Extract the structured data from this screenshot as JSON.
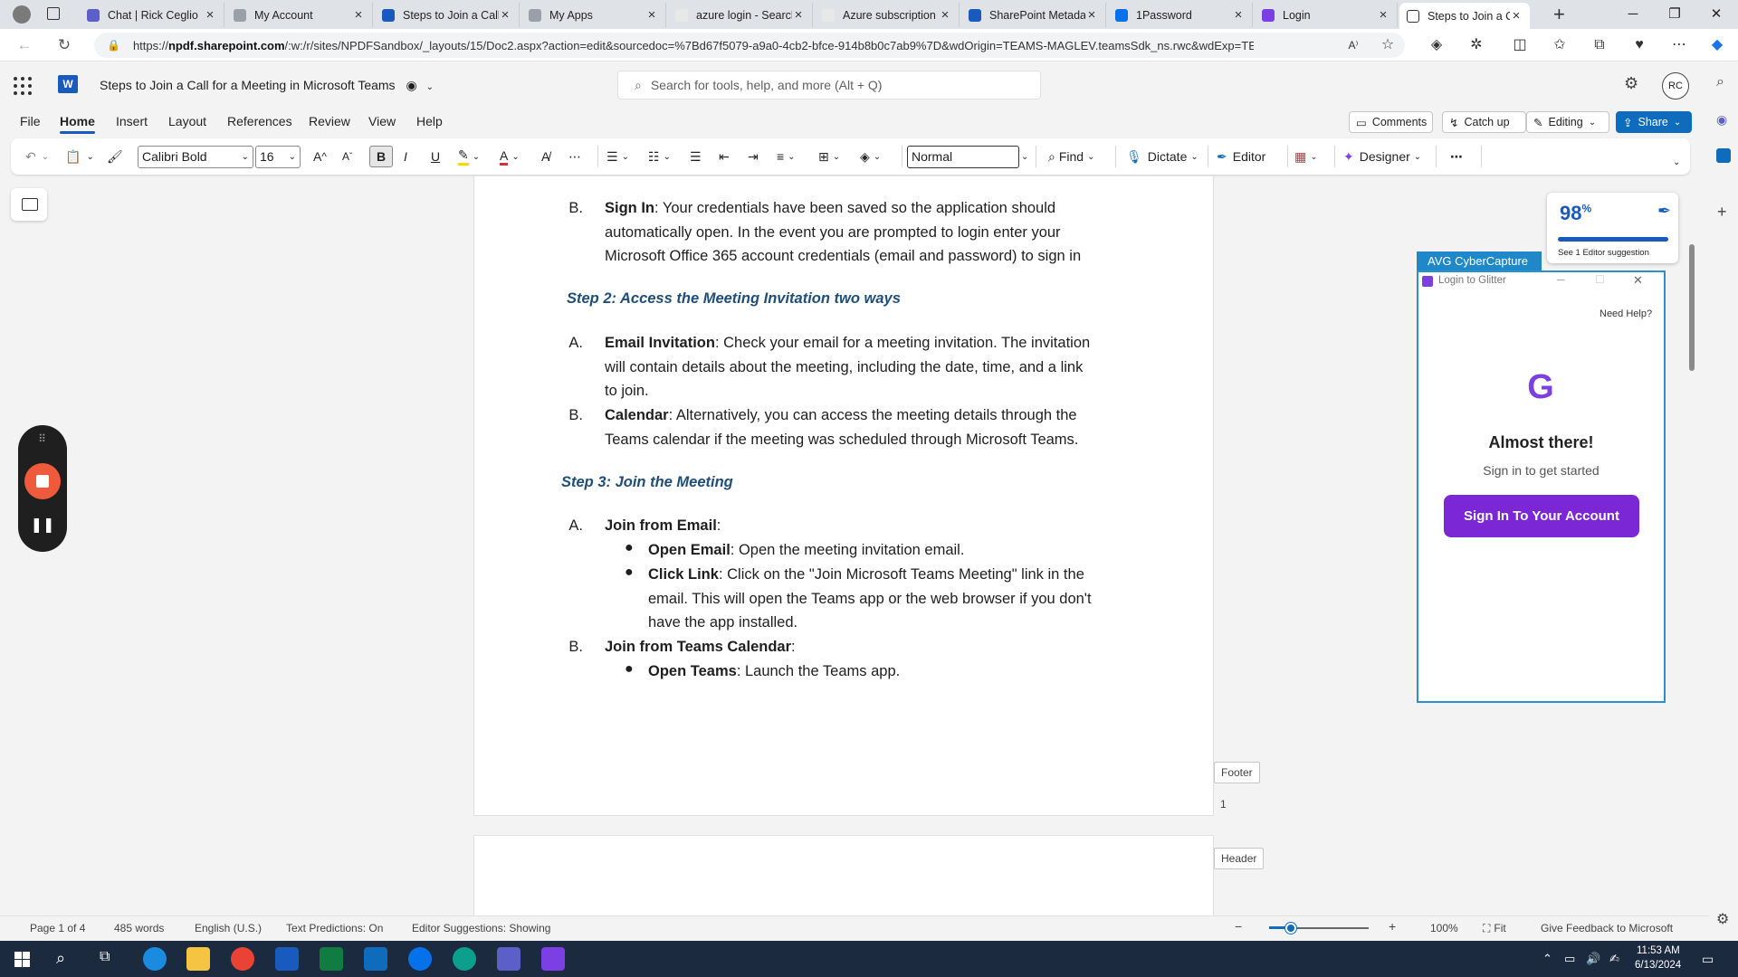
{
  "browser": {
    "tabs": [
      {
        "title": "Chat | Rick Ceglio",
        "color": "#5b5fc7",
        "active": false
      },
      {
        "title": "My Account",
        "color": "#9aa0a6",
        "active": false
      },
      {
        "title": "Steps to Join a Call",
        "color": "#185abd",
        "active": false
      },
      {
        "title": "My Apps",
        "color": "#9aa0a6",
        "active": false
      },
      {
        "title": "azure login - Search",
        "color": "#e8e8e8",
        "active": false
      },
      {
        "title": "Azure subscription",
        "color": "#e8e8e8",
        "active": false
      },
      {
        "title": "SharePoint Metadata",
        "color": "#185abd",
        "active": false
      },
      {
        "title": "1Password",
        "color": "#0572ec",
        "active": false
      },
      {
        "title": "Login",
        "color": "#7b3fe4",
        "active": false
      },
      {
        "title": "Steps to Join a Call",
        "color": "#ffffff",
        "active": true
      }
    ],
    "url_prefix": "https://",
    "url_domain": "npdf.sharepoint.com",
    "url_rest": "/:w:/r/sites/NPDFSandbox/_layouts/15/Doc2.aspx?action=edit&sourcedoc=%7Bd67f5079-a9a0-4cb2-bfce-914b8b0c7ab9%7D&wdOrigin=TEAMS-MAGLEV.teamsSdk_ns.rwc&wdExp=TE..."
  },
  "app": {
    "doc_title": "Steps to Join a Call for a Meeting in Microsoft Teams",
    "search_placeholder": "Search for tools, help, and more (Alt + Q)",
    "avatar": "RC",
    "menus": [
      "File",
      "Home",
      "Insert",
      "Layout",
      "References",
      "Review",
      "View",
      "Help"
    ],
    "active_menu": "Home",
    "comments": "Comments",
    "catch_up": "Catch up",
    "editing": "Editing",
    "share": "Share"
  },
  "ribbon": {
    "font": "Calibri Bold",
    "size": "16",
    "style": "Normal",
    "find": "Find",
    "dictate": "Dictate",
    "editor": "Editor",
    "designer": "Designer"
  },
  "document": {
    "b_signin_lbl": "B.",
    "b_signin_bold": "Sign In",
    "b_signin_text": ": Your credentials have been saved so the application should",
    "b_signin_l2": "automatically open. In the event you are prompted to login enter your",
    "b_signin_l3": "Microsoft Office 365 account credentials (email and password) to sign in",
    "step2": "Step 2: Access the Meeting Invitation two ways",
    "s2a_lbl": "A.",
    "s2a_bold": "Email Invitation",
    "s2a_l1": ": Check your email for a meeting invitation. The invitation",
    "s2a_l2": "will contain details about the meeting, including the date, time, and a link",
    "s2a_l3": "to join.",
    "s2b_lbl": "B.",
    "s2b_bold": "Calendar",
    "s2b_l1": ": Alternatively, you can access the meeting details through the",
    "s2b_l2": "Teams calendar if the meeting was scheduled through Microsoft Teams.",
    "step3": "Step 3: Join the Meeting",
    "s3a_lbl": "A.",
    "s3a_bold": "Join from Email",
    "s3a_colon": ":",
    "s3a_b1_bold": "Open Email",
    "s3a_b1_text": ": Open the meeting invitation email.",
    "s3a_b2_bold": "Click Link",
    "s3a_b2_l1": ": Click on the \"Join Microsoft Teams Meeting\" link in the",
    "s3a_b2_l2": "email. This will open the Teams app or the web browser if you don't",
    "s3a_b2_l3": "have the app installed.",
    "s3b_lbl": "B.",
    "s3b_bold": "Join from Teams Calendar",
    "s3b_colon": ":",
    "s3b_b1_bold": "Open Teams",
    "s3b_b1_text": ": Launch the Teams app.",
    "footer_label": "Footer",
    "page_number": "1",
    "header_label": "Header"
  },
  "editor_card": {
    "score": "98",
    "pct": "%",
    "suggestion": "See 1 Editor suggestion"
  },
  "avg": {
    "title": "AVG CyberCapture",
    "window_title": "Login to Glitter",
    "need_help": "Need Help?",
    "heading": "Almost there!",
    "subheading": "Sign in to get started",
    "button": "Sign In To Your Account"
  },
  "status": {
    "page": "Page 1 of 4",
    "words": "485 words",
    "language": "English (U.S.)",
    "predictions": "Text Predictions: On",
    "suggestions": "Editor Suggestions: Showing",
    "zoom": "100%",
    "fit": "Fit",
    "feedback": "Give Feedback to Microsoft"
  },
  "taskbar": {
    "time": "11:53 AM",
    "date": "6/13/2024"
  }
}
